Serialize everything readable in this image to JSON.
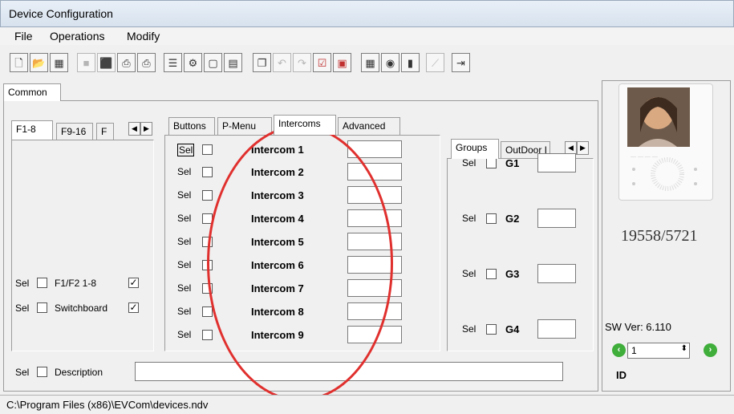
{
  "window": {
    "title": "Device Configuration"
  },
  "menu": [
    "File",
    "Operations",
    "Modify"
  ],
  "toolbar": {
    "buttons": [
      "new-icon",
      "open-icon",
      "import-icon",
      "save-icon",
      "stop-icon",
      "print-icon",
      "print-preview-icon",
      "list-icon",
      "config-icon",
      "window-icon",
      "copy-icon",
      "pages-icon",
      "undo-icon",
      "redo-icon",
      "check-icon",
      "calendar-icon",
      "grid-icon",
      "network-icon",
      "device-icon",
      "pin-icon",
      "exit-icon"
    ]
  },
  "tabs": {
    "top": "Common",
    "left": [
      "F1-8",
      "F9-16",
      "F"
    ],
    "middle": [
      "Buttons",
      "P-Menu",
      "Intercoms",
      "Advanced"
    ],
    "right": [
      "Groups",
      "OutDoor I"
    ]
  },
  "left_panel": {
    "rows": [
      {
        "sel": "Sel",
        "label": "F1/F2 1-8",
        "checked": true
      },
      {
        "sel": "Sel",
        "label": "Switchboard",
        "checked": true
      }
    ]
  },
  "intercoms": [
    {
      "sel": "Sel",
      "name": "Intercom 1",
      "value": ""
    },
    {
      "sel": "Sel",
      "name": "Intercom 2",
      "value": ""
    },
    {
      "sel": "Sel",
      "name": "Intercom 3",
      "value": ""
    },
    {
      "sel": "Sel",
      "name": "Intercom 4",
      "value": ""
    },
    {
      "sel": "Sel",
      "name": "Intercom 5",
      "value": ""
    },
    {
      "sel": "Sel",
      "name": "Intercom 6",
      "value": ""
    },
    {
      "sel": "Sel",
      "name": "Intercom 7",
      "value": ""
    },
    {
      "sel": "Sel",
      "name": "Intercom 8",
      "value": ""
    },
    {
      "sel": "Sel",
      "name": "Intercom 9",
      "value": ""
    }
  ],
  "groups": [
    {
      "sel": "Sel",
      "name": "G1",
      "value": ""
    },
    {
      "sel": "Sel",
      "name": "G2",
      "value": ""
    },
    {
      "sel": "Sel",
      "name": "G3",
      "value": ""
    },
    {
      "sel": "Sel",
      "name": "G4",
      "value": ""
    }
  ],
  "description": {
    "sel": "Sel",
    "label": "Description",
    "value": ""
  },
  "device": {
    "model": "19558/5721",
    "sw_version": "SW Ver: 6.110",
    "id_value": "1",
    "id_label": "ID"
  },
  "status": {
    "path": "C:\\Program Files (x86)\\EVCom\\devices.ndv"
  },
  "colors": {
    "highlight_circle": "#e0302e",
    "nav_green": "#3fae3a"
  }
}
